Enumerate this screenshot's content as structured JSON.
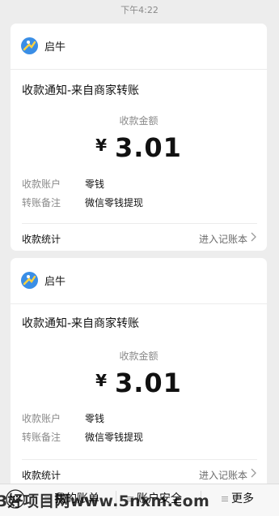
{
  "status_bar": {
    "time": "下午4:22"
  },
  "messages": [
    {
      "sender": "启牛",
      "title": "收款通知-来自商家转账",
      "amount_label": "收款金额",
      "currency_symbol": "¥",
      "amount": "3.01",
      "details": [
        {
          "key": "收款账户",
          "value": "零钱"
        },
        {
          "key": "转账备注",
          "value": "微信零钱提现"
        }
      ],
      "footer_label": "收款统计",
      "footer_action": "进入记账本"
    },
    {
      "sender": "启牛",
      "title": "收款通知-来自商家转账",
      "amount_label": "收款金额",
      "currency_symbol": "¥",
      "amount": "3.01",
      "details": [
        {
          "key": "收款账户",
          "value": "零钱"
        },
        {
          "key": "转账备注",
          "value": "微信零钱提现"
        }
      ],
      "footer_label": "收款统计",
      "footer_action": "进入记账本"
    }
  ],
  "bottom_menu": {
    "keyboard_icon": "keyboard-icon",
    "items": [
      {
        "label": "我的账单"
      },
      {
        "label": "账户安全"
      },
      {
        "label": "更多"
      }
    ]
  },
  "watermark": "3好项目网www.5nxm.com"
}
